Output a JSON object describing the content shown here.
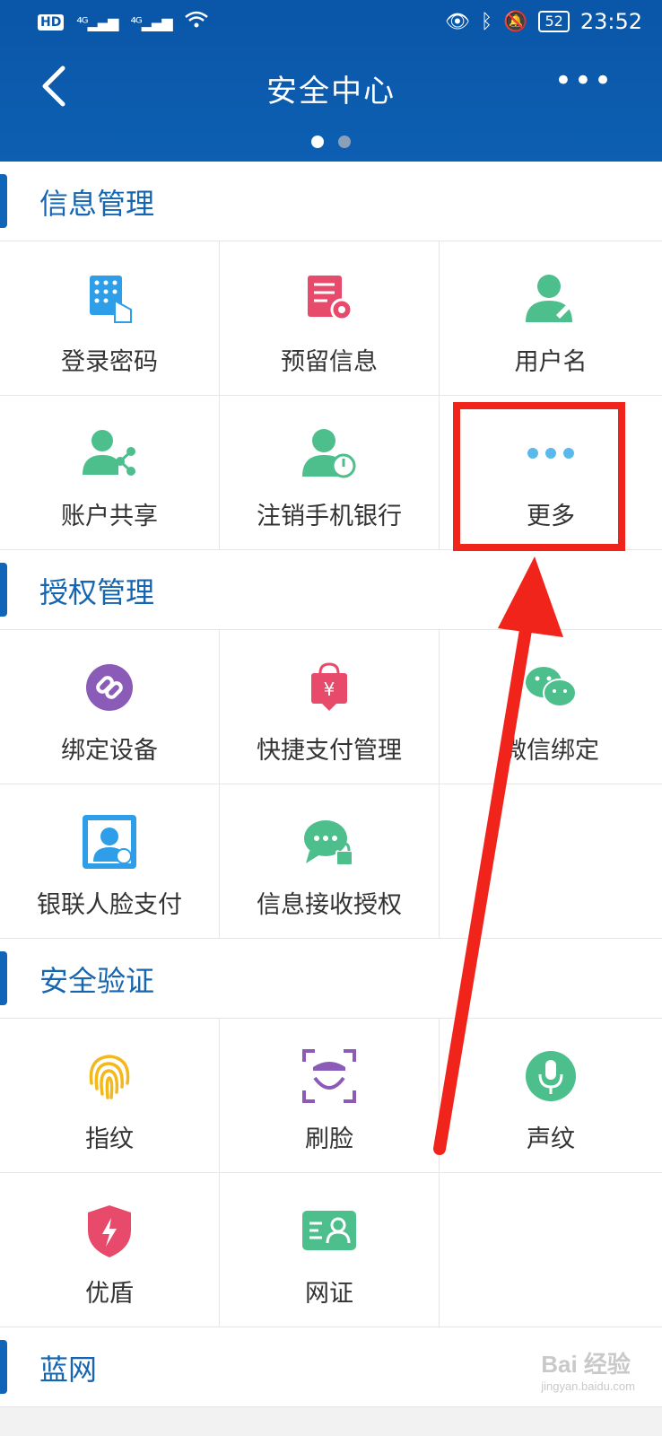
{
  "status_bar": {
    "left_icons": [
      "hd-icon",
      "signal-4g-icon",
      "signal-4g-icon",
      "wifi-icon"
    ],
    "right_icons": [
      "eye-icon",
      "bluetooth-icon",
      "mute-icon"
    ],
    "battery": "52",
    "time": "23:52"
  },
  "header": {
    "title": "安全中心",
    "page_dots": 2,
    "active_dot": 0
  },
  "sections": [
    {
      "title": "信息管理",
      "items": [
        {
          "label": "登录密码",
          "icon": "keypad-icon"
        },
        {
          "label": "预留信息",
          "icon": "document-gear-icon"
        },
        {
          "label": "用户名",
          "icon": "user-edit-icon"
        },
        {
          "label": "账户共享",
          "icon": "user-share-icon"
        },
        {
          "label": "注销手机银行",
          "icon": "user-power-icon"
        },
        {
          "label": "更多",
          "icon": "more-dots-icon"
        }
      ]
    },
    {
      "title": "授权管理",
      "items": [
        {
          "label": "绑定设备",
          "icon": "link-icon"
        },
        {
          "label": "快捷支付管理",
          "icon": "payment-bag-icon"
        },
        {
          "label": "微信绑定",
          "icon": "wechat-icon"
        },
        {
          "label": "银联人脸支付",
          "icon": "face-pay-icon"
        },
        {
          "label": "信息接收授权",
          "icon": "message-lock-icon"
        },
        {
          "label": "",
          "icon": ""
        }
      ]
    },
    {
      "title": "安全验证",
      "items": [
        {
          "label": "指纹",
          "icon": "fingerprint-icon"
        },
        {
          "label": "刷脸",
          "icon": "face-scan-icon"
        },
        {
          "label": "声纹",
          "icon": "microphone-icon"
        },
        {
          "label": "优盾",
          "icon": "shield-icon"
        },
        {
          "label": "网证",
          "icon": "id-card-icon"
        },
        {
          "label": "",
          "icon": ""
        }
      ]
    },
    {
      "title": "蓝网",
      "items": []
    }
  ],
  "watermark": {
    "text": "Bai 经验",
    "sub": "jingyan.baidu.com"
  },
  "colors": {
    "header": "#0a56a8",
    "accent": "#1565b0",
    "annotation": "#f1241b"
  }
}
